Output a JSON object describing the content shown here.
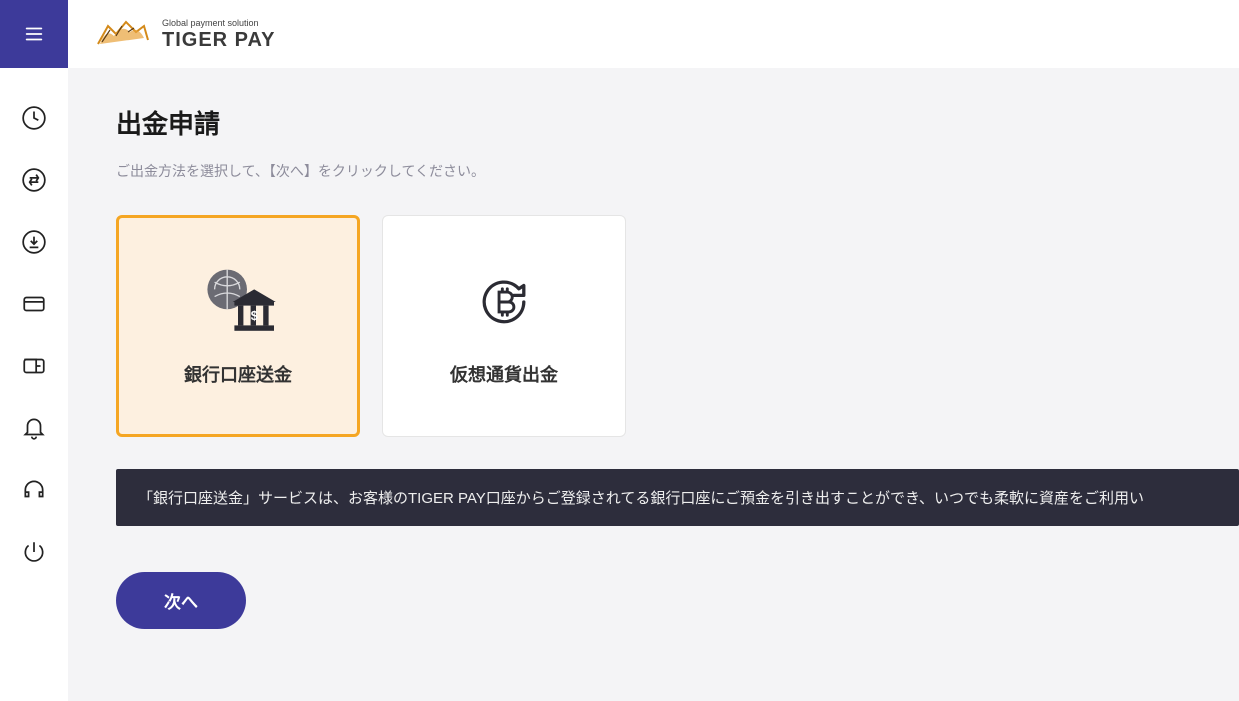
{
  "brand": {
    "tagline": "Global payment solution",
    "name": "TIGER PAY"
  },
  "sidebar": {
    "items": [
      {
        "name": "clock-icon"
      },
      {
        "name": "exchange-icon"
      },
      {
        "name": "withdraw-icon"
      },
      {
        "name": "card-icon"
      },
      {
        "name": "wallet-icon"
      },
      {
        "name": "bell-icon"
      },
      {
        "name": "headset-icon"
      },
      {
        "name": "power-icon"
      }
    ]
  },
  "page": {
    "title": "出金申請",
    "subtitle": "ご出金方法を選択して、【次へ】をクリックしてください。"
  },
  "options": {
    "bank": {
      "label": "銀行口座送金",
      "selected": true
    },
    "crypto": {
      "label": "仮想通貨出金",
      "selected": false
    }
  },
  "tooltip": {
    "text": "「銀行口座送金」サービスは、お客様のTIGER PAY口座からご登録されてる銀行口座にご預金を引き出すことができ、いつでも柔軟に資産をご利用い"
  },
  "buttons": {
    "next": "次へ"
  },
  "colors": {
    "primary": "#3d3a9a",
    "accent": "#f5a623",
    "selectedBg": "#fdf0e0",
    "tooltipBg": "#2d2d3c"
  }
}
